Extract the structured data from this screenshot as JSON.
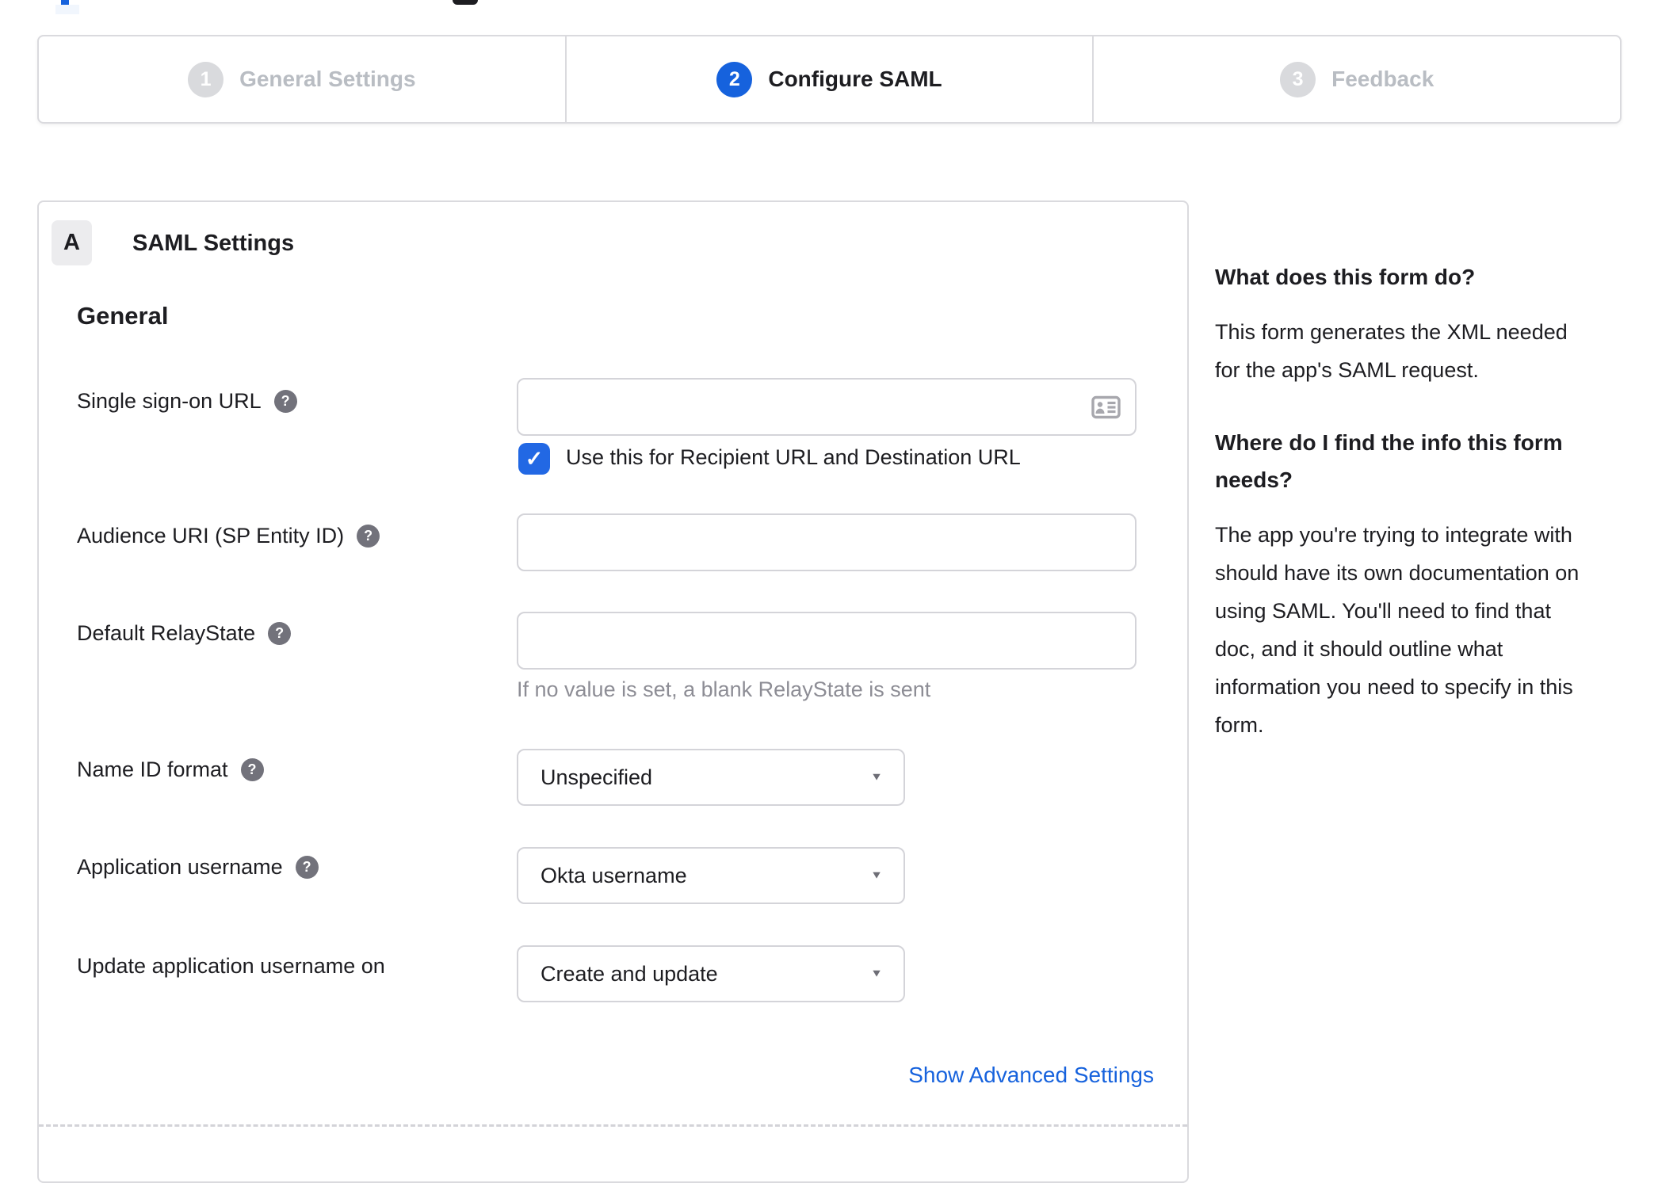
{
  "colors": {
    "accent_blue": "#1662dd",
    "checkbox_blue": "#2268e4",
    "link_blue": "#1662dd"
  },
  "stepper": {
    "steps": [
      {
        "number": "1",
        "label": "General Settings",
        "state": "inactive"
      },
      {
        "number": "2",
        "label": "Configure SAML",
        "state": "active"
      },
      {
        "number": "3",
        "label": "Feedback",
        "state": "inactive"
      }
    ]
  },
  "panel": {
    "badge": "A",
    "title": "SAML Settings",
    "section_heading": "General",
    "help_icon_glyph": "?",
    "checkmark_glyph": "✓",
    "caret_glyph": "▼",
    "fields": {
      "sso": {
        "label": "Single sign-on URL",
        "value": "",
        "checkbox_checked": true,
        "checkbox_label": "Use this for Recipient URL and Destination URL"
      },
      "audience": {
        "label": "Audience URI (SP Entity ID)",
        "value": ""
      },
      "relay_state": {
        "label": "Default RelayState",
        "value": "",
        "hint": "If no value is set, a blank RelayState is sent"
      },
      "name_id_format": {
        "label": "Name ID format",
        "value": "Unspecified"
      },
      "application_username": {
        "label": "Application username",
        "value": "Okta username"
      },
      "update_application_username_on": {
        "label": "Update application username on",
        "value": "Create and update"
      }
    },
    "advanced_link": "Show Advanced Settings"
  },
  "sidebar": {
    "section1": {
      "title": "What does this form do?",
      "body_lines": [
        "This form generates the XML needed",
        "for the app's SAML request."
      ]
    },
    "section2": {
      "title_lines": [
        "Where do I find the info this form",
        "needs?"
      ],
      "body_lines": [
        "The app you're trying to integrate with",
        "should have its own documentation on",
        "using SAML. You'll need to find that",
        "doc, and it should outline what",
        "information you need to specify in this",
        "form."
      ]
    }
  }
}
